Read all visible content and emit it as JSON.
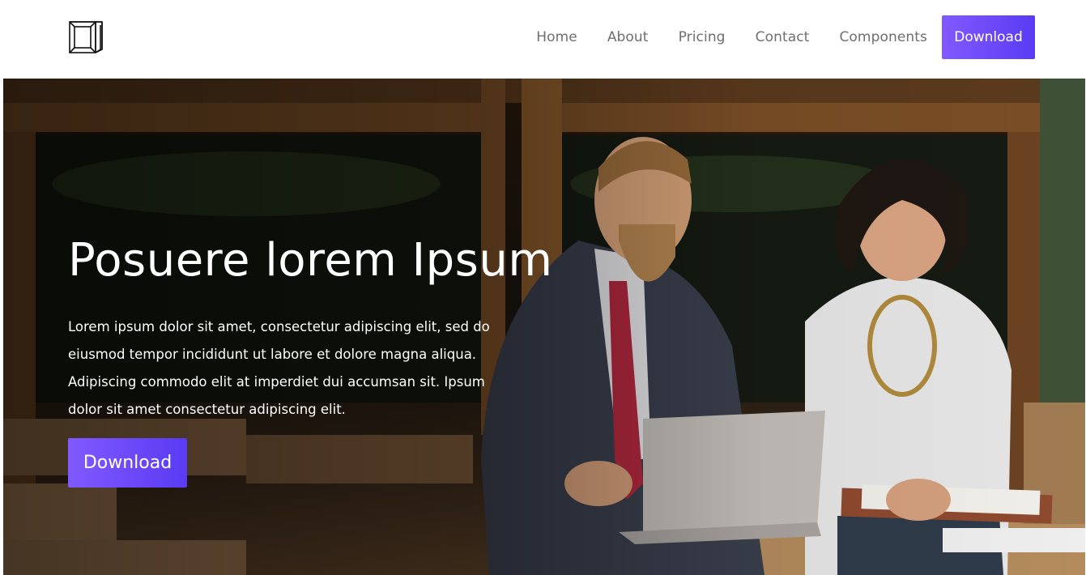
{
  "nav": {
    "logo_icon": "cube-outline-logo",
    "links": [
      "Home",
      "About",
      "Pricing",
      "Contact",
      "Components"
    ],
    "download_label": "Download"
  },
  "hero": {
    "title": "Posuere lorem Ipsum",
    "text": "Lorem ipsum dolor sit amet, consectetur adipiscing elit, sed do eiusmod tempor incididunt ut labore et dolore magna aliqua. Adipiscing commodo elit at imperdiet dui accumsan sit. Ipsum dolor sit amet consectetur adipiscing elit.",
    "button_label": "Download",
    "image": "photo-two-people-working-at-laptop-in-cafe"
  },
  "colors": {
    "accent_start": "#8159ff",
    "accent_end": "#5a3bf3",
    "nav_text": "#6f6f6f"
  }
}
